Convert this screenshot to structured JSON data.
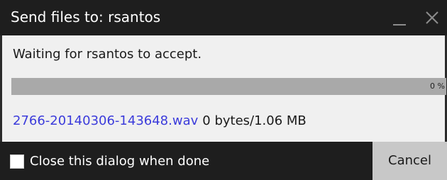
{
  "window": {
    "title": "Send files to: rsantos"
  },
  "titlebar": {
    "minimize_icon": "minimize-icon",
    "close_icon": "close-icon"
  },
  "status": {
    "message": "Waiting for rsantos to accept."
  },
  "progress": {
    "percent": 0,
    "label": "0 %",
    "track_color": "#a9a9a9"
  },
  "file": {
    "name": "2766-20140306-143648.wav",
    "size_text": "0 bytes/1.06 MB",
    "link_color": "#3b3bdb"
  },
  "footer": {
    "close_when_done_label": "Close this dialog when done",
    "close_when_done_checked": false,
    "cancel_label": "Cancel"
  }
}
